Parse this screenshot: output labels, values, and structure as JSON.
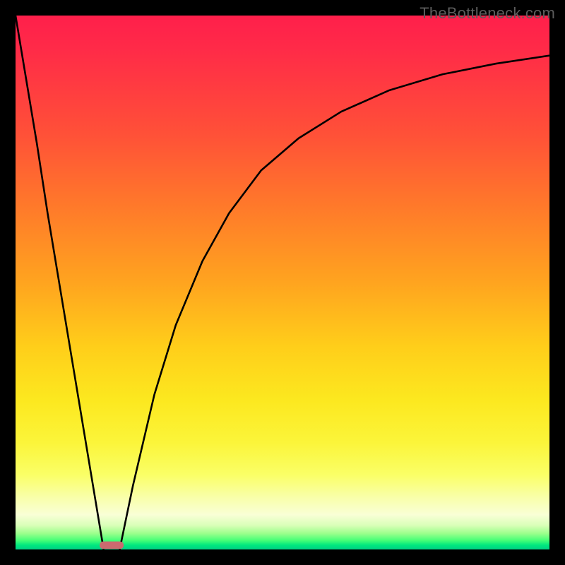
{
  "watermark": "TheBottleneck.com",
  "chart_data": {
    "type": "line",
    "title": "",
    "xlabel": "",
    "ylabel": "",
    "xlim": [
      0,
      100
    ],
    "ylim": [
      0,
      100
    ],
    "grid": false,
    "legend": false,
    "annotations": [],
    "background_gradient": {
      "direction": "vertical",
      "stops": [
        {
          "pos": 0.0,
          "color": "#ff1f4b"
        },
        {
          "pos": 0.5,
          "color": "#ffa41f"
        },
        {
          "pos": 0.8,
          "color": "#fbf53a"
        },
        {
          "pos": 0.95,
          "color": "#f9ffd6"
        },
        {
          "pos": 1.0,
          "color": "#00d084"
        }
      ]
    },
    "series": [
      {
        "name": "left-branch",
        "x": [
          0,
          2,
          4,
          6,
          8,
          10,
          12,
          14,
          16,
          16.5
        ],
        "y": [
          100,
          88,
          76,
          63,
          51,
          39,
          27,
          15,
          3,
          0
        ]
      },
      {
        "name": "right-branch",
        "x": [
          19.5,
          22,
          26,
          30,
          35,
          40,
          46,
          53,
          61,
          70,
          80,
          90,
          100
        ],
        "y": [
          0,
          12,
          29,
          42,
          54,
          63,
          71,
          77,
          82,
          86,
          89,
          91,
          92.5
        ]
      }
    ],
    "marker": {
      "x": 18,
      "y": 0.8,
      "width": 4.5,
      "height": 1.4,
      "color": "#cc6a6f",
      "shape": "rounded-rect"
    }
  }
}
